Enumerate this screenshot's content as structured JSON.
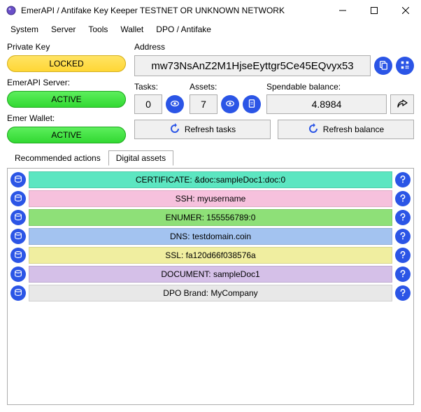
{
  "window": {
    "title": "EmerAPI / Antifake Key Keeper TESTNET OR UNKNOWN NETWORK"
  },
  "menu": {
    "items": [
      "System",
      "Server",
      "Tools",
      "Wallet",
      "DPO / Antifake"
    ]
  },
  "left": {
    "pk_label": "Private Key",
    "pk_state": "LOCKED",
    "srv_label": "EmerAPI Server:",
    "srv_state": "ACTIVE",
    "wal_label": "Emer Wallet:",
    "wal_state": "ACTIVE"
  },
  "addr": {
    "label": "Address",
    "value": "mw73NsAnZ2M1HjseEyttgr5Ce45EQvyx53"
  },
  "stats": {
    "tasks_label": "Tasks:",
    "tasks_value": "0",
    "assets_label": "Assets:",
    "assets_value": "7",
    "balance_label": "Spendable balance:",
    "balance_value": "4.8984"
  },
  "refresh": {
    "tasks": "Refresh tasks",
    "balance": "Refresh balance"
  },
  "tabs": {
    "rec": "Recommended actions",
    "assets": "Digital assets"
  },
  "assets": [
    {
      "label": "CERTIFICATE: &doc:sampleDoc1:doc:0",
      "cls": "c-cert"
    },
    {
      "label": "SSH: myusername",
      "cls": "c-ssh"
    },
    {
      "label": "ENUMER: 155556789:0",
      "cls": "c-enum"
    },
    {
      "label": "DNS: testdomain.coin",
      "cls": "c-dns"
    },
    {
      "label": "SSL: fa120d66f038576a",
      "cls": "c-ssl"
    },
    {
      "label": "DOCUMENT: sampleDoc1",
      "cls": "c-doc"
    },
    {
      "label": "DPO Brand: MyCompany",
      "cls": "c-brand"
    }
  ]
}
